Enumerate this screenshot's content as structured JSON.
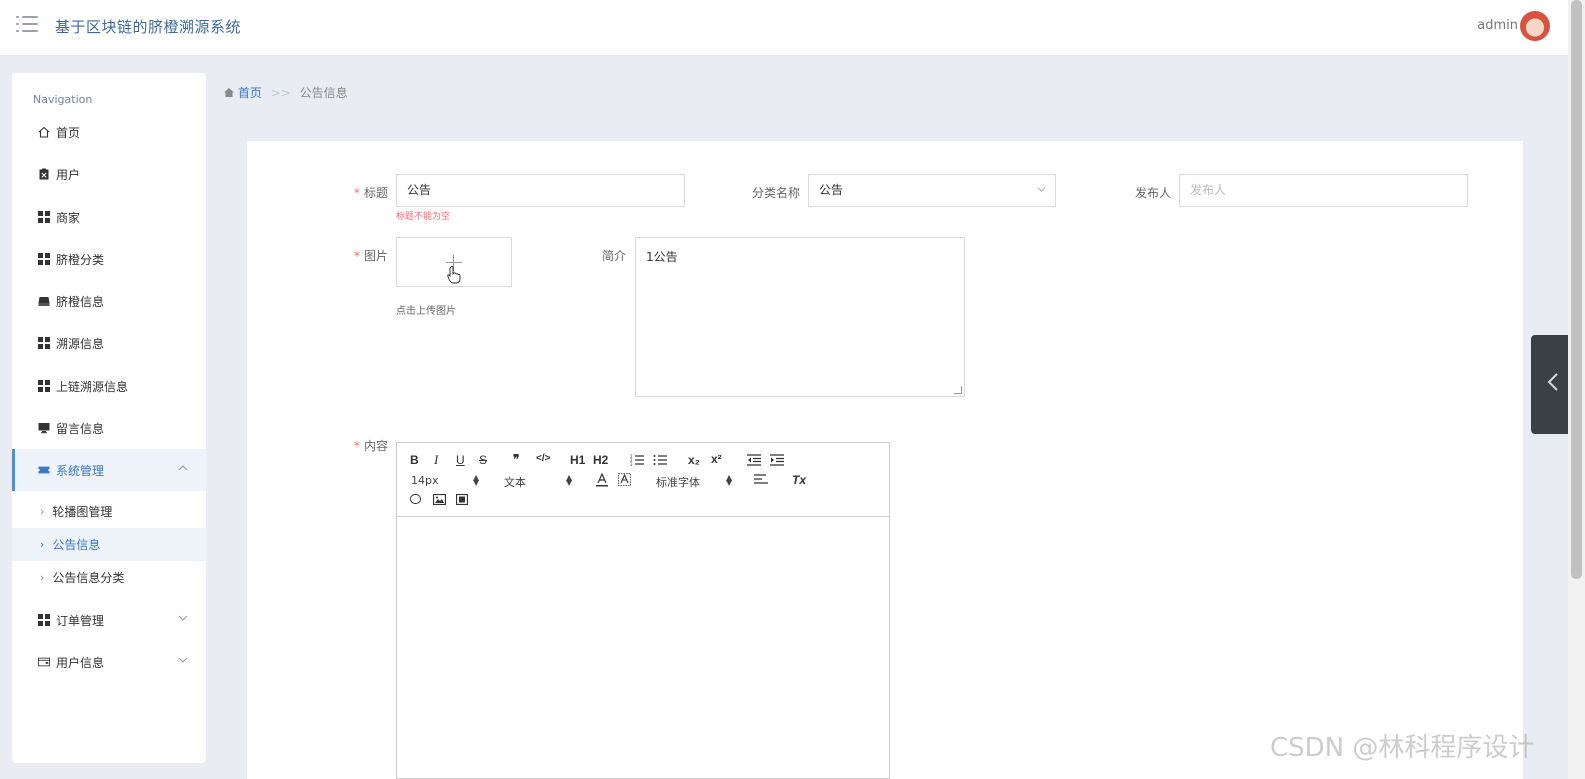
{
  "header": {
    "app_title": "基于区块链的脐橙溯源系统",
    "user_name": "admin"
  },
  "sidebar": {
    "heading": "Navigation",
    "items": [
      {
        "label": "首页",
        "icon": "home-icon"
      },
      {
        "label": "用户",
        "icon": "clipboard-icon"
      },
      {
        "label": "商家",
        "icon": "grid-icon"
      },
      {
        "label": "脐橙分类",
        "icon": "grid-icon"
      },
      {
        "label": "脐橙信息",
        "icon": "inbox-icon"
      },
      {
        "label": "溯源信息",
        "icon": "grid-icon"
      },
      {
        "label": "上链溯源信息",
        "icon": "grid-icon"
      },
      {
        "label": "留言信息",
        "icon": "monitor-icon"
      },
      {
        "label": "系统管理",
        "icon": "ticket-icon"
      },
      {
        "label": "订单管理",
        "icon": "grid-icon"
      },
      {
        "label": "用户信息",
        "icon": "wallet-icon"
      }
    ],
    "sub_items": [
      {
        "label": "轮播图管理"
      },
      {
        "label": "公告信息"
      },
      {
        "label": "公告信息分类"
      }
    ]
  },
  "breadcrumb": {
    "home": "首页",
    "separator": ">>",
    "current": "公告信息"
  },
  "form": {
    "title_label": "标题",
    "title_value": "公告",
    "title_error": "标题不能为空",
    "category_label": "分类名称",
    "category_value": "公告",
    "publisher_label": "发布人",
    "publisher_placeholder": "发布人",
    "image_label": "图片",
    "upload_hint": "点击上传图片",
    "intro_label": "简介",
    "intro_value": "1公告",
    "content_label": "内容",
    "required_mark": "*"
  },
  "editor": {
    "bold": "B",
    "italic": "I",
    "underline": "U",
    "strike": "S",
    "quote": "❞",
    "code": "</>",
    "h1": "H1",
    "h2": "H2",
    "size_value": "14px",
    "header_value": "文本",
    "font_value": "标准字体",
    "subscript": "x₂",
    "superscript": "x²",
    "clean": "Tx"
  },
  "watermark": "CSDN @林科程序设计",
  "colors": {
    "accent": "#3b78c0",
    "error": "#f56c6c",
    "background": "#e9ecf3"
  }
}
